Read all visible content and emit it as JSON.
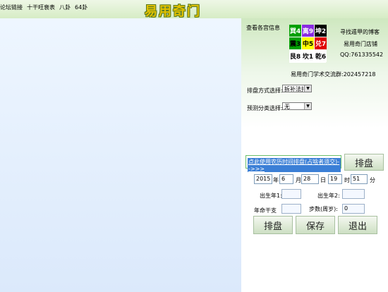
{
  "menu": [
    "论坛链接",
    "十干旺衰表",
    "八卦",
    "64卦"
  ],
  "brand": "易用奇门",
  "palace_info_label": "查看各宫信息",
  "grid": [
    {
      "text": "巽4",
      "bg": "#00a000",
      "fg": "#ffffff"
    },
    {
      "text": "离9",
      "bg": "#8a2be2",
      "fg": "#ffffff"
    },
    {
      "text": "坤2",
      "bg": "#000000",
      "fg": "#ffffff"
    },
    {
      "text": "震3",
      "bg": "#00a000",
      "fg": "#000000"
    },
    {
      "text": "中5",
      "bg": "#ffff00",
      "fg": "#000000"
    },
    {
      "text": "兑7",
      "bg": "#e00000",
      "fg": "#ffffff"
    },
    {
      "text": "艮8",
      "bg": "#ffffff",
      "fg": "#000000"
    },
    {
      "text": "坎1",
      "bg": "#ffffff",
      "fg": "#000000"
    },
    {
      "text": "乾6",
      "bg": "#ffffff",
      "fg": "#000000"
    }
  ],
  "side": {
    "line1": "寻找遁甲的博客",
    "line2": "易用奇门店铺",
    "line3": "QQ:761335542"
  },
  "group_text": "易用奇门学术交流群:202457218",
  "layout_label": "排盘方式选择:",
  "layout_value": "拆补法排",
  "category_label": "预测分类选择:",
  "category_value": "无",
  "link_text": "点此使用农历时间排盘(占啥者须交)-->>>",
  "paipan_top": "排盘",
  "date": {
    "year": "2015",
    "year_unit": "年",
    "month": "6",
    "month_unit": "月",
    "day": "28",
    "day_unit": "日",
    "hour": "19",
    "hour_unit": "时",
    "minute": "51",
    "minute_unit": "分"
  },
  "labels": {
    "birth1": "出生年1:",
    "birth2": "出生年2:",
    "ganzhi": "年命干支",
    "steps": "步数(周岁):"
  },
  "steps_value": "0",
  "buttons": {
    "paipan": "排盘",
    "save": "保存",
    "exit": "退出"
  }
}
